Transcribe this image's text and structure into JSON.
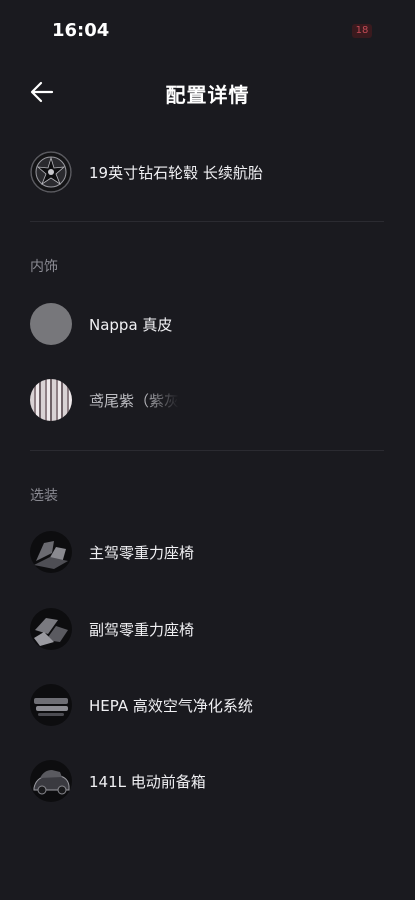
{
  "status_bar": {
    "time": "16:04",
    "battery": "18"
  },
  "header": {
    "title": "配置详情"
  },
  "wheels": {
    "label": "19英寸钻石轮毂 长续航胎"
  },
  "interior": {
    "section_title": "内饰",
    "items": [
      {
        "label": "Nappa 真皮"
      },
      {
        "label": "鸢尾紫（紫灰"
      }
    ]
  },
  "options": {
    "section_title": "选装",
    "items": [
      {
        "label": "主驾零重力座椅"
      },
      {
        "label": "副驾零重力座椅"
      },
      {
        "label": "HEPA 高效空气净化系统"
      },
      {
        "label": "141L 电动前备箱"
      }
    ]
  }
}
